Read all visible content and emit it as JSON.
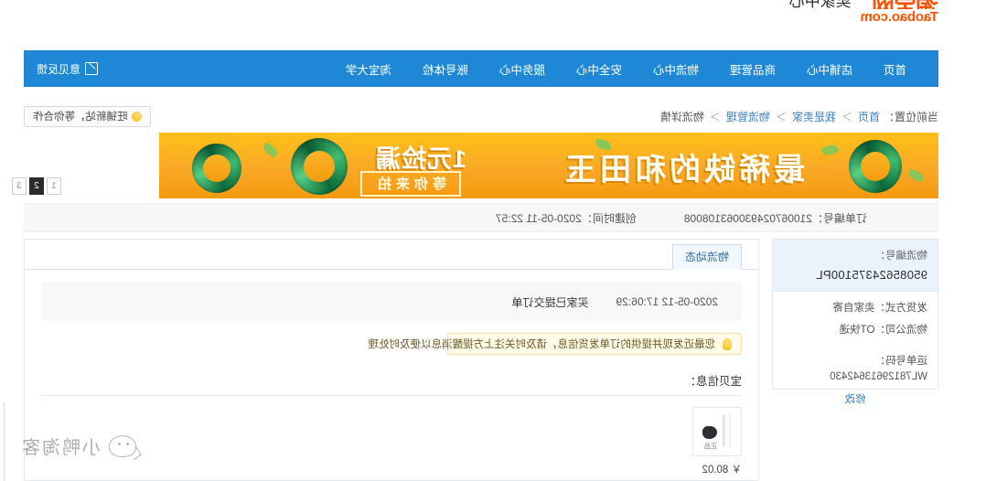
{
  "header": {
    "logo_cn": "淘宝网",
    "logo_en": "Taobao.com",
    "logo_sub": "卖家中心"
  },
  "nav": {
    "items": [
      {
        "label": "首页",
        "name": "nav-home"
      },
      {
        "label": "店铺中心",
        "name": "nav-shop-center"
      },
      {
        "label": "商品管理",
        "name": "nav-item-manage"
      },
      {
        "label": "物流中心",
        "name": "nav-logistics-center"
      },
      {
        "label": "安全中心",
        "name": "nav-security-center"
      },
      {
        "label": "服务中心",
        "name": "nav-service-center"
      },
      {
        "label": "账号体检",
        "name": "nav-account-check"
      },
      {
        "label": "淘宝大学",
        "name": "nav-taobao-university"
      }
    ],
    "right_label": "意见反馈",
    "right_icon": "feedback-icon"
  },
  "breadcrumb": {
    "prefix": "当前位置：",
    "items": [
      "首页",
      "我是卖家",
      "物流管理"
    ],
    "current": "物流详情",
    "separator": "＞",
    "notice_label": "旺铺新站，等你合作",
    "notice_icon": "bulb-icon"
  },
  "banner": {
    "title": "最稀缺的和田玉",
    "price_text": "1元捡漏",
    "sub_text": "等你来拍",
    "bg_color": "#f9a826"
  },
  "pager": {
    "pages": [
      "1",
      "2",
      "3"
    ],
    "active_index": 1
  },
  "order": {
    "order_no_label": "订单编号：",
    "order_no_value": "210067024930063108008",
    "created_label": "创建时间：",
    "created_value": "2020-05-11 22:57"
  },
  "sidebar": {
    "logistics_no_label": "物流编号：",
    "logistics_no_value": "95085624375100PL",
    "ship_method_label": "发货方式：",
    "ship_method_value": "卖家自寄",
    "company_label": "物流公司：",
    "company_value": "OT快递",
    "waybill_label": "运单号码：",
    "waybill_value": "WL78129613642430",
    "modify_link": "修改"
  },
  "main": {
    "tab_label": "物流动态",
    "trace": {
      "timestamp": "2020-05-12 17:06:29",
      "message": "买家已提交订单",
      "highlight_color": "#f0b90b"
    },
    "notice": {
      "icon": "bulb-icon",
      "text": "您最近发现并提供的订单发货信息，请及时关注上方提醒消息以便及时处理"
    },
    "goods_title": "宝贝信息：",
    "goods": [
      {
        "thumb_name": "product-thumbnail",
        "thumb_tag": "正品",
        "price": "￥ 80.02"
      }
    ]
  },
  "watermark": {
    "text": "小鸭淘客",
    "icon": "wechat-icon"
  }
}
